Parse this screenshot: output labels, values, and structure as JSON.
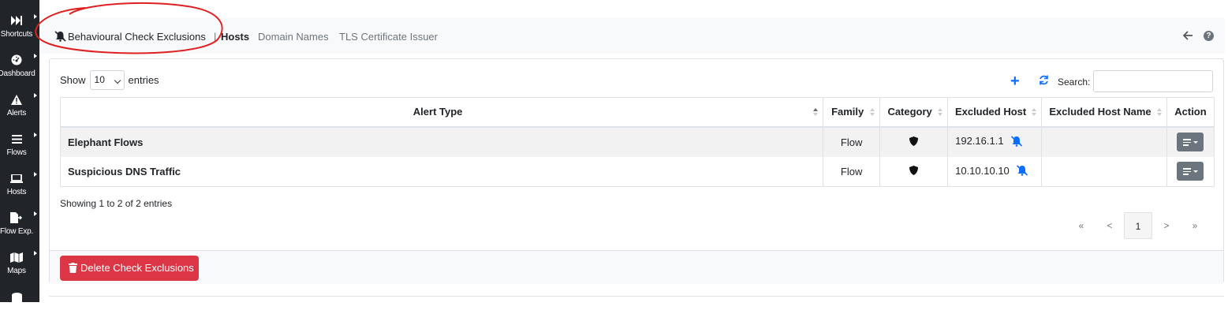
{
  "sidebar": {
    "items": [
      {
        "label": "Shortcuts",
        "icon": "fast-forward-icon"
      },
      {
        "label": "Dashboard",
        "icon": "dashboard-icon"
      },
      {
        "label": "Alerts",
        "icon": "warning-icon"
      },
      {
        "label": "Flows",
        "icon": "list-icon"
      },
      {
        "label": "Hosts",
        "icon": "laptop-icon"
      },
      {
        "label": "Flow Exp.",
        "icon": "file-export-icon"
      },
      {
        "label": "Maps",
        "icon": "map-icon"
      },
      {
        "label": "",
        "icon": "database-icon"
      }
    ]
  },
  "header": {
    "title": "Behavioural Check Exclusions",
    "separator": "|",
    "active_tab": "Hosts",
    "tabs": [
      "Domain Names",
      "TLS Certificate Issuer"
    ]
  },
  "controls": {
    "show_label": "Show",
    "entries_value": "10",
    "entries_label": "entries",
    "search_label": "Search:",
    "search_value": ""
  },
  "table": {
    "columns": [
      "Alert Type",
      "Family",
      "Category",
      "Excluded Host",
      "Excluded Host Name",
      "Action"
    ],
    "rows": [
      {
        "alert_type": "Elephant Flows",
        "family": "Flow",
        "category_icon": "shield-icon",
        "excluded_host": "192.16.1.1",
        "excluded_host_name": ""
      },
      {
        "alert_type": "Suspicious DNS Traffic",
        "family": "Flow",
        "category_icon": "shield-icon",
        "excluded_host": "10.10.10.10",
        "excluded_host_name": ""
      }
    ]
  },
  "info": "Showing 1 to 2 of 2 entries",
  "pagination": {
    "first": "«",
    "prev": "<",
    "current": "1",
    "next": ">",
    "last": "»"
  },
  "footer": {
    "delete_label": "Delete Check Exclusions"
  },
  "colors": {
    "sidebar": "#212529",
    "primary": "#0d6efd",
    "danger": "#dc3545",
    "secondary": "#6c757d",
    "annotation": "#e02020"
  }
}
